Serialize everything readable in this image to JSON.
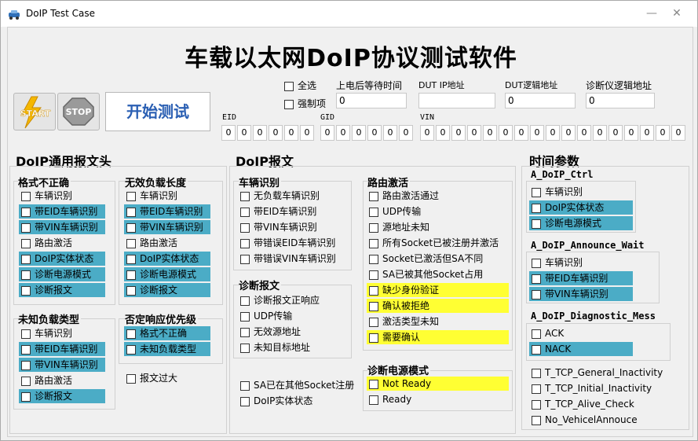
{
  "window": {
    "title": "DoIP Test Case",
    "minimize": "—",
    "close": "✕"
  },
  "main_title": "车载以太网DoIP协议测试软件",
  "toolbar": {
    "start_label": "START",
    "stop_label": "STOP",
    "go_label": "开始测试"
  },
  "options": {
    "select_all": "全选",
    "force": "强制项"
  },
  "config": {
    "power_wait_label": "上电后等待时间",
    "power_wait_value": "0",
    "dut_ip_label": "DUT IP地址",
    "dut_ip_value": "",
    "dut_logic_label": "DUT逻辑地址",
    "dut_logic_value": "0",
    "tester_logic_label": "诊断仪逻辑地址",
    "tester_logic_value": "0"
  },
  "ids": {
    "eid_label": "EID",
    "eid": [
      "0",
      "0",
      "0",
      "0",
      "0",
      "0"
    ],
    "gid_label": "GID",
    "gid": [
      "0",
      "0",
      "0",
      "0",
      "0",
      "0"
    ],
    "vin_label": "VIN",
    "vin": [
      "0",
      "0",
      "0",
      "0",
      "0",
      "0",
      "0",
      "0",
      "0",
      "0",
      "0",
      "0",
      "0",
      "0",
      "0",
      "0",
      "0"
    ]
  },
  "header_section": {
    "title": "DoIP通用报文头",
    "format_error": {
      "title": "格式不正确",
      "items": [
        "车辆识别",
        "带EID车辆识别",
        "带VIN车辆识别",
        "路由激活",
        "DoIP实体状态",
        "诊断电源模式",
        "诊断报文"
      ]
    },
    "invalid_length": {
      "title": "无效负载长度",
      "items": [
        "车辆识别",
        "带EID车辆识别",
        "带VIN车辆识别",
        "路由激活",
        "DoIP实体状态",
        "诊断电源模式",
        "诊断报文"
      ]
    },
    "unknown_type": {
      "title": "未知负载类型",
      "items": [
        "车辆识别",
        "带EID车辆识别",
        "带VIN车辆识别",
        "路由激活",
        "诊断报文"
      ]
    },
    "nack_priority": {
      "title": "否定响应优先级",
      "items": [
        "格式不正确",
        "未知负载类型"
      ]
    },
    "too_long": "报文过大"
  },
  "doip_section": {
    "title": "DoIP报文",
    "vehicle_id": {
      "title": "车辆识别",
      "items": [
        "无负载车辆识别",
        "带EID车辆识别",
        "带VIN车辆识别",
        "带错误EID车辆识别",
        "带错误VIN车辆识别"
      ]
    },
    "diag_msg": {
      "title": "诊断报文",
      "items": [
        "诊断报文正响应",
        "UDP传输",
        "无效源地址",
        "未知目标地址"
      ]
    },
    "routing": {
      "title": "路由激活",
      "items": [
        "路由激活通过",
        "UDP传输",
        "源地址未知",
        "所有Socket已被注册并激活",
        "Socket已激活但SA不同",
        "SA已被其他Socket占用",
        "缺少身份验证",
        "确认被拒绝",
        "激活类型未知",
        "需要确认"
      ]
    },
    "power_mode": {
      "title": "诊断电源模式",
      "items": [
        "Not Ready",
        "Ready"
      ]
    },
    "extra": [
      "SA已在其他Socket注册",
      "DoIP实体状态"
    ]
  },
  "time_section": {
    "title": "时间参数",
    "ctrl": {
      "title": "A_DoIP_Ctrl",
      "items": [
        "车辆识别",
        "DoIP实体状态",
        "诊断电源模式"
      ]
    },
    "announce": {
      "title": "A_DoIP_Announce_Wait",
      "items": [
        "车辆识别",
        "带EID车辆识别",
        "带VIN车辆识别"
      ]
    },
    "diag": {
      "title": "A_DoIP_Diagnostic_Mess",
      "items": [
        "ACK",
        "NACK"
      ]
    },
    "tcp": [
      "T_TCP_General_Inactivity",
      "T_TCP_Initial_Inactivity",
      "T_TCP_Alive_Check",
      "No_VehicelAnnouce"
    ]
  },
  "colors": {
    "highlight_cyan": "#4bacc6",
    "highlight_yellow": "#ffff33",
    "go_text": "#2a5fb3"
  }
}
